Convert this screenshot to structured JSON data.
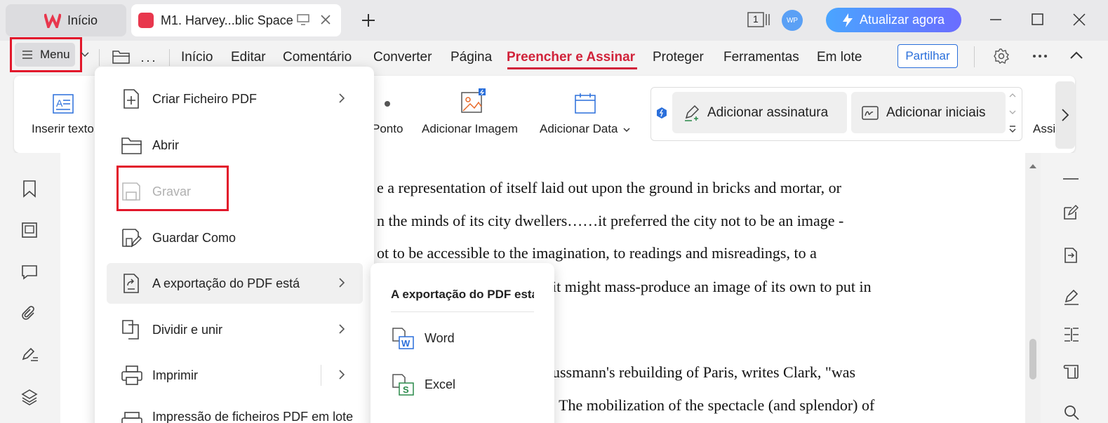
{
  "titlebar": {
    "home_tab": "Início",
    "doc_tab": "M1. Harvey...blic Space",
    "page_count": "1",
    "avatar": "WP",
    "upgrade": "Atualizar agora"
  },
  "menubar": {
    "menu": "Menu",
    "tabs": [
      "Início",
      "Editar",
      "Comentário",
      "Converter",
      "Página",
      "Preencher e Assinar",
      "Proteger",
      "Ferramentas",
      "Em lote"
    ],
    "active_tab": "Preencher e Assinar",
    "share": "Partilhar"
  },
  "ribbon": {
    "insert_text": "Inserir texto",
    "dot": "Ponto",
    "add_image": "Adicionar Imagem",
    "add_date": "Adicionar Data",
    "add_signature": "Adicionar assinatura",
    "add_initials": "Adicionar iniciais",
    "cut_label": "Assi"
  },
  "document": {
    "lines": [
      "e a representation of itself laid out upon the ground in bricks and mortar, or",
      "n the minds of its city dwellers……it preferred the city not to be an image -",
      "ot to be accessible to the imagination, to readings and misreadings, to a",
      "it might mass-produce an image of its own to put in",
      "ussmann's rebuilding of Paris, writes Clark, \"was",
      "' The mobilization of the spectacle (and splendor) of"
    ]
  },
  "mainmenu": {
    "items": [
      {
        "label": "Criar Ficheiro PDF"
      },
      {
        "label": "Abrir"
      },
      {
        "label": "Gravar"
      },
      {
        "label": "Guardar Como"
      },
      {
        "label": "A exportação do PDF está"
      },
      {
        "label": "Dividir e unir"
      },
      {
        "label": "Imprimir"
      },
      {
        "label": "Impressão de ficheiros PDF em lote"
      }
    ]
  },
  "submenu": {
    "title": "A exportação do PDF está",
    "items": [
      {
        "label": "Word"
      },
      {
        "label": "Excel"
      }
    ]
  },
  "colors": {
    "accent": "#d1233a",
    "highlight": "#e2182b",
    "link": "#2a6fdb"
  }
}
